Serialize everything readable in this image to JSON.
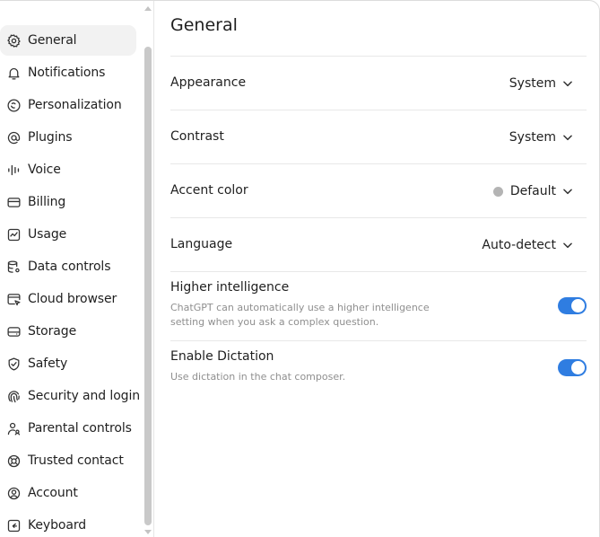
{
  "colors": {
    "accent": "#2f7de1",
    "accent_dot": "#b4b4b4",
    "active_nav_bg": "#f2f2f2"
  },
  "sidebar": {
    "items": [
      {
        "label": "General",
        "icon": "gear-icon",
        "active": true
      },
      {
        "label": "Notifications",
        "icon": "bell-icon"
      },
      {
        "label": "Personalization",
        "icon": "personalization-icon"
      },
      {
        "label": "Plugins",
        "icon": "at-sign-icon"
      },
      {
        "label": "Voice",
        "icon": "waveform-icon"
      },
      {
        "label": "Billing",
        "icon": "credit-card-icon"
      },
      {
        "label": "Usage",
        "icon": "activity-chart-icon"
      },
      {
        "label": "Data controls",
        "icon": "database-gear-icon"
      },
      {
        "label": "Cloud browser",
        "icon": "browser-icon"
      },
      {
        "label": "Storage",
        "icon": "hard-drive-icon"
      },
      {
        "label": "Safety",
        "icon": "shield-check-icon"
      },
      {
        "label": "Security and login",
        "icon": "fingerprint-icon"
      },
      {
        "label": "Parental controls",
        "icon": "parent-icon"
      },
      {
        "label": "Trusted contact",
        "icon": "lifebuoy-icon"
      },
      {
        "label": "Account",
        "icon": "user-circle-icon"
      },
      {
        "label": "Keyboard",
        "icon": "keyboard-icon"
      }
    ]
  },
  "main": {
    "title": "General",
    "appearance": {
      "label": "Appearance",
      "value": "System"
    },
    "contrast": {
      "label": "Contrast",
      "value": "System"
    },
    "accent_color": {
      "label": "Accent color",
      "value": "Default"
    },
    "language": {
      "label": "Language",
      "value": "Auto-detect"
    },
    "higher_intelligence": {
      "label": "Higher intelligence",
      "description_line1": "ChatGPT can automatically use a higher intelligence",
      "description_line2": "setting when you ask a complex question.",
      "enabled": true
    },
    "dictation": {
      "label": "Enable Dictation",
      "description": "Use dictation in the chat composer.",
      "enabled": true
    }
  }
}
